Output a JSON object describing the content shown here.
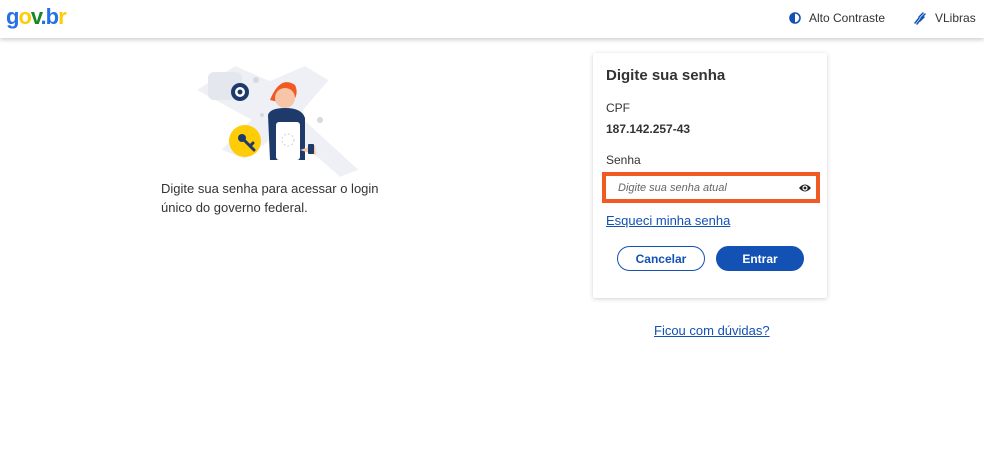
{
  "header": {
    "logo": {
      "g": "g",
      "o": "o",
      "v": "v",
      "dot": ".",
      "b": "b",
      "r": "r"
    },
    "high_contrast_label": "Alto Contraste",
    "high_contrast_icon": "contrast-icon",
    "vlibras_label": "VLibras",
    "vlibras_icon": "hand-sign-icon"
  },
  "intro": {
    "text": "Digite sua senha para acessar o login único do governo federal.",
    "illustration": "woman-with-key-illustration"
  },
  "login_card": {
    "title": "Digite sua senha",
    "cpf_label": "CPF",
    "cpf_value": "187.142.257-43",
    "password_label": "Senha",
    "password_placeholder": "Digite sua senha atual",
    "password_value": "",
    "show_password_icon": "eye-icon",
    "forgot_link": "Esqueci minha senha",
    "cancel_label": "Cancelar",
    "enter_label": "Entrar"
  },
  "help_link": "Ficou com dúvidas?",
  "colors": {
    "primary": "#1351b4",
    "highlight_border": "#f15a22",
    "text": "#333333"
  }
}
